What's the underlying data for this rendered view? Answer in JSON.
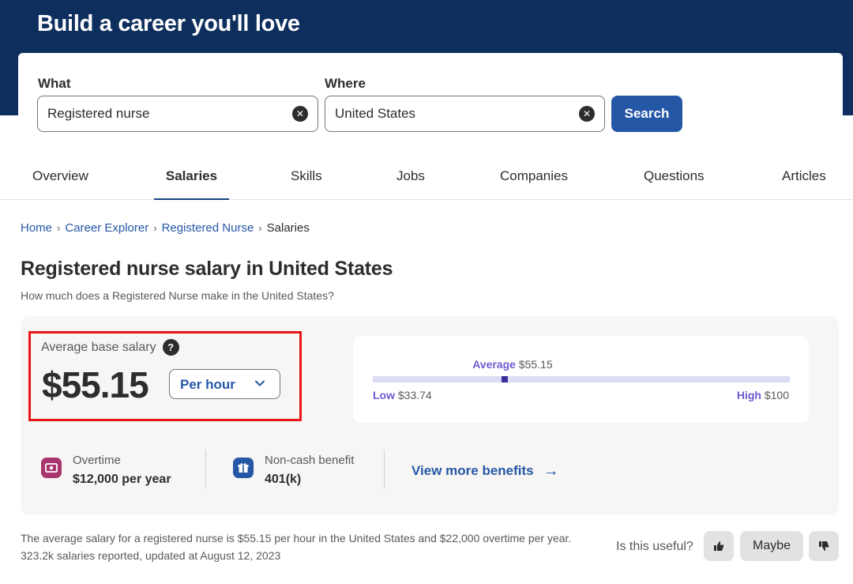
{
  "hero": {
    "title": "Build a career you'll love"
  },
  "search": {
    "what_label": "What",
    "what_value": "Registered nurse",
    "where_label": "Where",
    "where_value": "United States",
    "button_label": "Search"
  },
  "tabs": [
    {
      "label": "Overview"
    },
    {
      "label": "Salaries",
      "active": true
    },
    {
      "label": "Skills"
    },
    {
      "label": "Jobs"
    },
    {
      "label": "Companies"
    },
    {
      "label": "Questions"
    },
    {
      "label": "Articles"
    }
  ],
  "breadcrumb": [
    {
      "label": "Home"
    },
    {
      "label": "Career Explorer"
    },
    {
      "label": "Registered Nurse"
    },
    {
      "label": "Salaries"
    }
  ],
  "page": {
    "title": "Registered nurse salary in United States",
    "subtitle": "How much does a Registered Nurse make in the United States?"
  },
  "salary": {
    "label": "Average base salary",
    "help": "?",
    "value": "$55.15",
    "period": "Per hour"
  },
  "range": {
    "avg_label": "Average",
    "avg_value": "$55.15",
    "low_label": "Low",
    "low_value": "$33.74",
    "high_label": "High",
    "high_value": "$100",
    "avg_numeric": 55.15,
    "low_numeric": 33.74,
    "high_numeric": 100
  },
  "benefits": [
    {
      "label": "Overtime",
      "value": "$12,000 per year",
      "icon": "cash-icon",
      "color": "#a8356d"
    },
    {
      "label": "Non-cash benefit",
      "value": "401(k)",
      "icon": "gift-icon",
      "color": "#2557a7"
    }
  ],
  "more_benefits": {
    "label": "View more benefits"
  },
  "summary": "The average salary for a registered nurse is $55.15 per hour in the United States and $22,000 overtime per year. 323.2k salaries reported, updated at August 12, 2023",
  "feedback": {
    "question": "Is this useful?",
    "maybe": "Maybe"
  },
  "colors": {
    "hero_bg": "#0e2f5e",
    "primary": "#2557a7",
    "range_accent": "#6f5ad1",
    "highlight": "#e8151b"
  }
}
